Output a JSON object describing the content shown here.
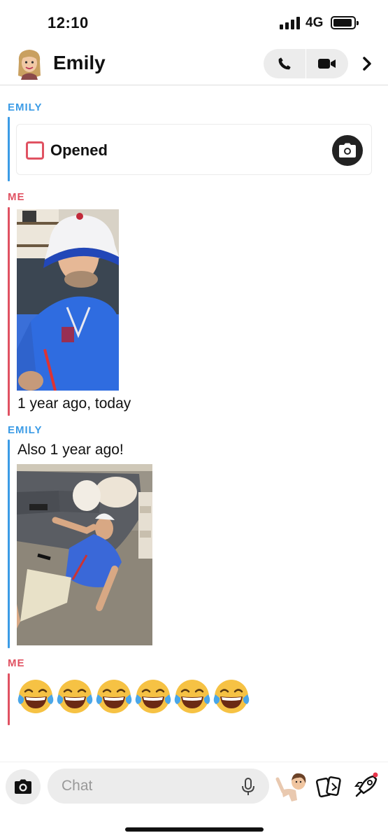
{
  "status_bar": {
    "time": "12:10",
    "network": "4G"
  },
  "header": {
    "name": "Emily"
  },
  "messages": [
    {
      "sender": "EMILY",
      "type": "snap",
      "status": "Opened"
    },
    {
      "sender": "ME",
      "type": "photo",
      "caption": "1 year ago, today"
    },
    {
      "sender": "EMILY",
      "type": "photo",
      "text": "Also 1 year ago!"
    },
    {
      "sender": "ME",
      "type": "emoji",
      "emoji": "😂😂😂😂😂😂"
    }
  ],
  "composer": {
    "placeholder": "Chat"
  },
  "colors": {
    "emily": "#3b9be6",
    "me": "#e05262"
  },
  "icons": [
    "phone-icon",
    "video-icon",
    "chevron-right-icon",
    "camera-icon",
    "microphone-icon",
    "bitmoji-icon",
    "cards-icon",
    "rocket-icon"
  ]
}
